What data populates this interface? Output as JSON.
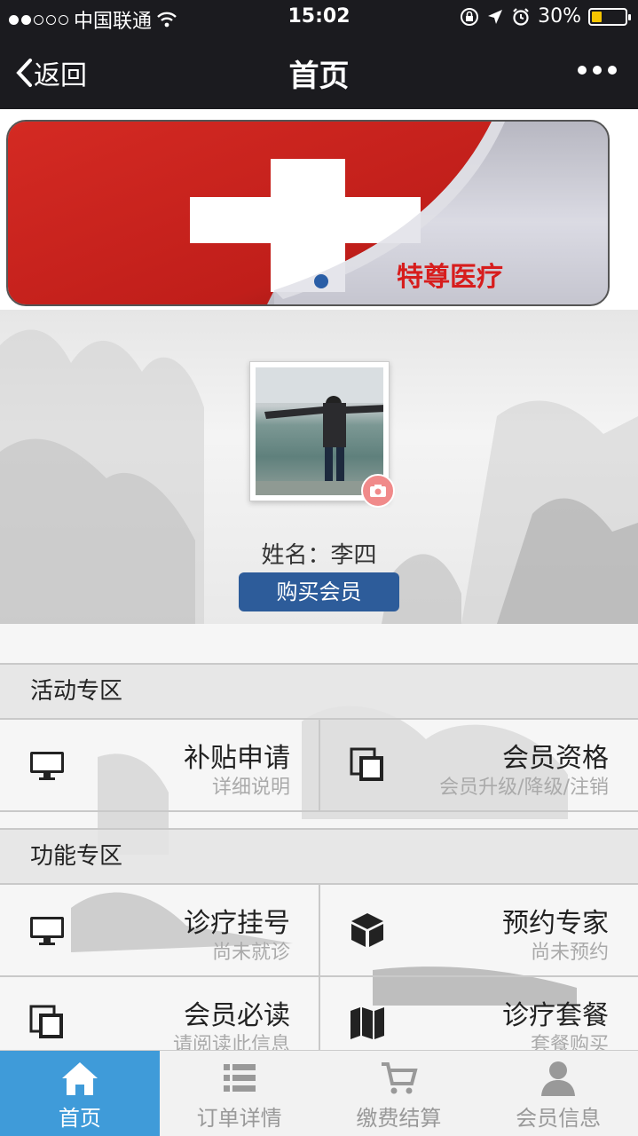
{
  "status_bar": {
    "carrier": "中国联通",
    "time": "15:02",
    "battery": "30%",
    "battery_level": 0.3
  },
  "nav": {
    "back_label": "返回",
    "title": "首页"
  },
  "banner": {
    "text": "特尊医疗"
  },
  "profile": {
    "name_line": "姓名：李四",
    "buy_button": "购买会员"
  },
  "activity_section": {
    "title": "活动专区",
    "items": [
      {
        "title": "补贴申请",
        "subtitle": "详细说明",
        "icon": "monitor-icon"
      },
      {
        "title": "会员资格",
        "subtitle": "会员升级/降级/注销",
        "icon": "copy-icon"
      }
    ]
  },
  "function_section": {
    "title": "功能专区",
    "items": [
      {
        "title": "诊疗挂号",
        "subtitle": "尚未就诊",
        "icon": "monitor-icon"
      },
      {
        "title": "预约专家",
        "subtitle": "尚未预约",
        "icon": "cube-icon"
      },
      {
        "title": "会员必读",
        "subtitle": "请阅读此信息",
        "icon": "copy-icon"
      },
      {
        "title": "诊疗套餐",
        "subtitle": "套餐购买",
        "icon": "map-icon"
      }
    ]
  },
  "tabs": [
    {
      "label": "首页",
      "icon": "home-icon",
      "active": true
    },
    {
      "label": "订单详情",
      "icon": "list-icon",
      "active": false
    },
    {
      "label": "缴费结算",
      "icon": "cart-icon",
      "active": false
    },
    {
      "label": "会员信息",
      "icon": "user-icon",
      "active": false
    }
  ]
}
